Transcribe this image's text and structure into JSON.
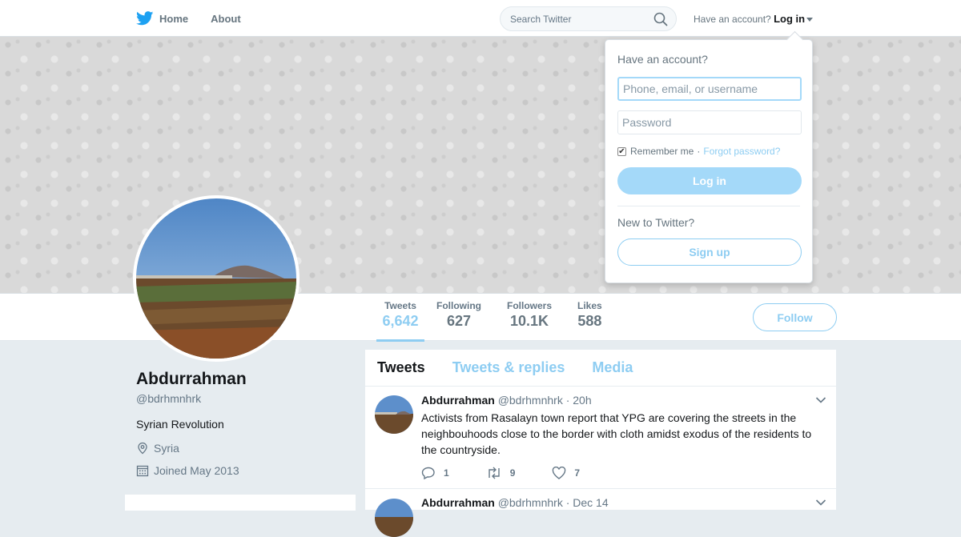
{
  "nav": {
    "home_label": "Home",
    "about_label": "About",
    "search_placeholder": "Search Twitter",
    "account_prompt": "Have an account?",
    "login_label": "Log in"
  },
  "profile": {
    "name": "Abdurrahman",
    "handle": "@bdrhmnhrk",
    "bio": "Syrian Revolution",
    "location": "Syria",
    "joined": "Joined May 2013"
  },
  "stats": [
    {
      "label": "Tweets",
      "value": "6,642"
    },
    {
      "label": "Following",
      "value": "627"
    },
    {
      "label": "Followers",
      "value": "10.1K"
    },
    {
      "label": "Likes",
      "value": "588"
    }
  ],
  "follow_label": "Follow",
  "tabs": [
    "Tweets",
    "Tweets & replies",
    "Media"
  ],
  "tweets": [
    {
      "name": "Abdurrahman",
      "handle": "@bdrhmnhrk",
      "time": "· 20h",
      "text": "Activists from Rasalayn town report that YPG are covering the streets in the neighbouhoods close to the border with cloth amidst exodus of the residents to the countryside.",
      "replies": "1",
      "retweets": "9",
      "likes": "7"
    },
    {
      "name": "Abdurrahman",
      "handle": "@bdrhmnhrk",
      "time": "· Dec 14"
    }
  ],
  "login_dropdown": {
    "title": "Have an account?",
    "user_placeholder": "Phone, email, or username",
    "password_placeholder": "Password",
    "remember_label": "Remember me",
    "separator": "·",
    "forgot_label": "Forgot password?",
    "login_button": "Log in",
    "new_prompt": "New to Twitter?",
    "signup_button": "Sign up"
  },
  "colors": {
    "accent": "#8ecdf2",
    "brand": "#1da1f2",
    "text": "#14171a",
    "muted": "#657786"
  }
}
